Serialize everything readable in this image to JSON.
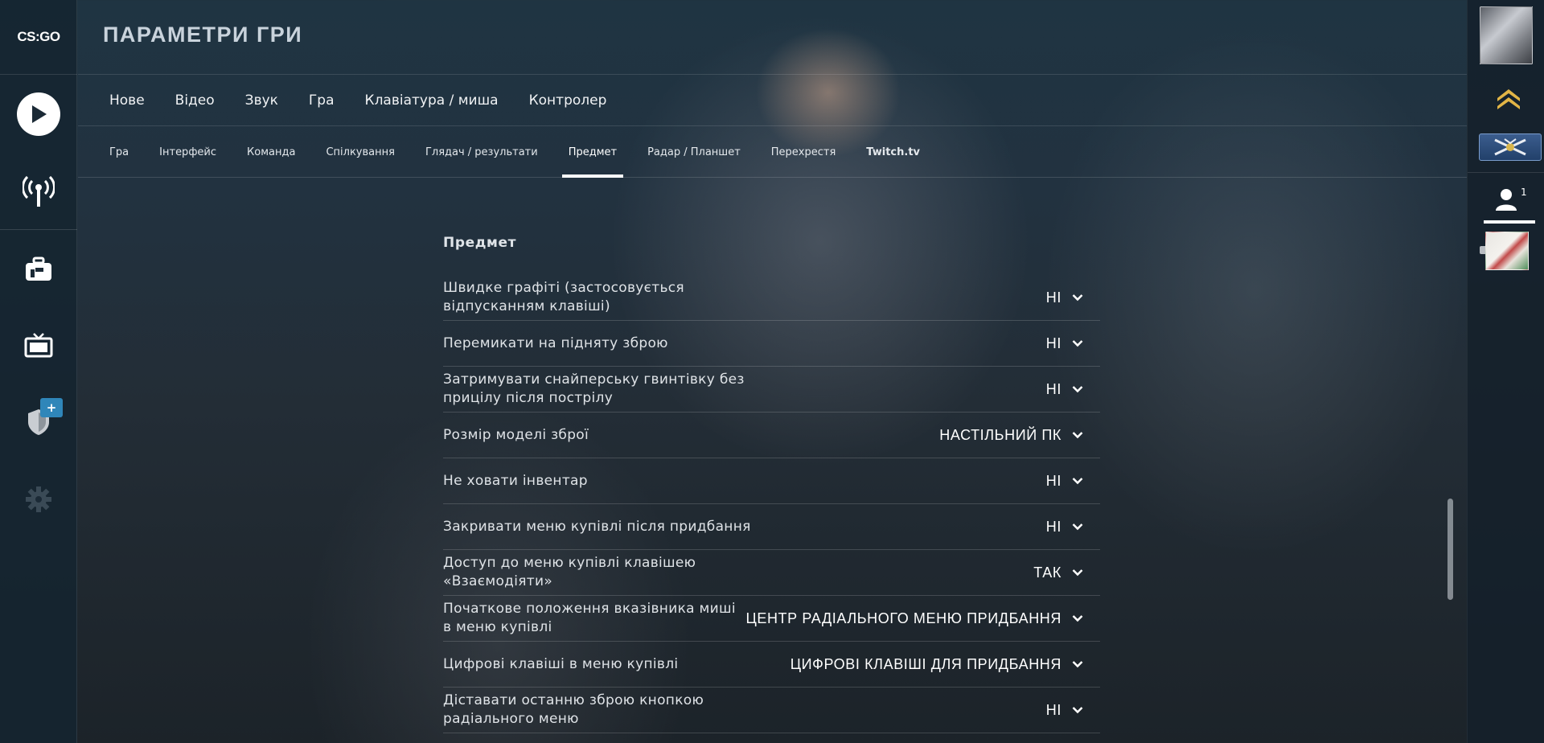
{
  "logo": {
    "text": "CS:GO"
  },
  "header": {
    "title": "ПАРАМЕТРИ ГРИ"
  },
  "main_tabs": [
    {
      "label": "Нове"
    },
    {
      "label": "Відео"
    },
    {
      "label": "Звук"
    },
    {
      "label": "Гра"
    },
    {
      "label": "Клавіатура / миша"
    },
    {
      "label": "Контролер"
    }
  ],
  "sub_tabs": [
    {
      "label": "Гра"
    },
    {
      "label": "Інтерфейс"
    },
    {
      "label": "Команда"
    },
    {
      "label": "Спілкування"
    },
    {
      "label": "Глядач / результати"
    },
    {
      "label": "Предмет",
      "active": true
    },
    {
      "label": "Радар / Планшет"
    },
    {
      "label": "Перехрестя"
    },
    {
      "label": "Twitch.tv"
    }
  ],
  "section": {
    "title": "Предмет",
    "settings": [
      {
        "label": "Швидке графіті (застосовується відпусканням клавіші)",
        "value": "НІ"
      },
      {
        "label": "Перемикати на підняту зброю",
        "value": "НІ"
      },
      {
        "label": "Затримувати снайперську гвинтівку без прицілу після пострілу",
        "value": "НІ"
      },
      {
        "label": "Розмір моделі зброї",
        "value": "НАСТІЛЬНИЙ ПК"
      },
      {
        "label": "Не ховати інвентар",
        "value": "НІ"
      },
      {
        "label": "Закривати меню купівлі після придбання",
        "value": "НІ"
      },
      {
        "label": "Доступ до меню купівлі клавішею «Взаємодіяти»",
        "value": "ТАК"
      },
      {
        "label": "Початкове положення вказівника миші в меню купівлі",
        "value": "ЦЕНТР РАДІАЛЬНОГО МЕНЮ ПРИДБАННЯ"
      },
      {
        "label": "Цифрові клавіші в меню купівлі",
        "value": "ЦИФРОВІ КЛАВІШІ ДЛЯ ПРИДБАННЯ"
      },
      {
        "label": "Діставати останню зброю кнопкою радіального меню",
        "value": "НІ"
      }
    ]
  },
  "left_rail": {
    "icons": [
      "play-icon",
      "broadcast-icon",
      "briefcase-icon",
      "tv-icon",
      "shield-icon",
      "gear-icon"
    ],
    "badge": "+"
  },
  "right_rail": {
    "friends_count": "1"
  },
  "colors": {
    "accent_blue": "#2f86b9",
    "active_underline": "#ffffff"
  }
}
